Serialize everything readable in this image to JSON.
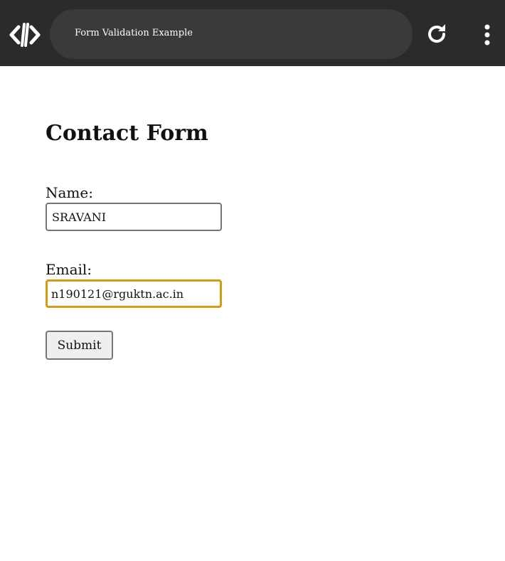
{
  "browser": {
    "page_title": "Form Validation Example",
    "logo_icon": "code-brackets-icon",
    "reload_icon": "reload-icon",
    "menu_icon": "more-vertical-icon"
  },
  "form": {
    "heading": "Contact Form",
    "name_label": "Name:",
    "name_value": "SRAVANI",
    "email_label": "Email:",
    "email_value": "n190121@rguktn.ac.in",
    "submit_label": "Submit",
    "focus_color": "#d79a13"
  }
}
